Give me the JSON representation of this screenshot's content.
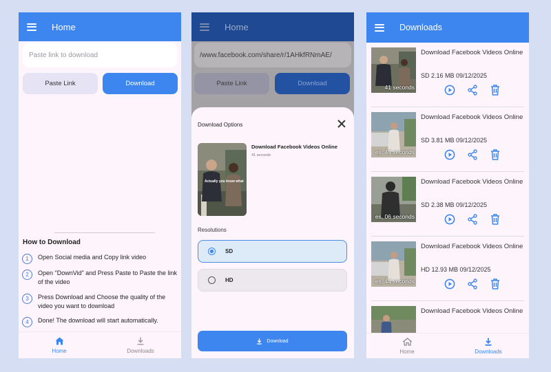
{
  "colors": {
    "accent": "#3d86f0",
    "background": "#d6def3",
    "phone_bg": "#fdf5fb"
  },
  "home": {
    "title": "Home",
    "input_placeholder": "Paste link to download",
    "paste_label": "Paste Link",
    "download_label": "Download",
    "howto_title": "How to Download",
    "steps": [
      {
        "num": "1",
        "text": "Open Social media and Copy link video"
      },
      {
        "num": "2",
        "text": "Open \"DownVid\" and Press Paste to Paste the link of the video"
      },
      {
        "num": "3",
        "text": "Press Download and Choose the quality of the video you want to download"
      },
      {
        "num": "4",
        "text": "Done! The download will start automatically."
      }
    ],
    "nav": {
      "home": "Home",
      "downloads": "Downloads"
    }
  },
  "options": {
    "title": "Home",
    "url_value": "/www.facebook.com/share/r/1AHkfRNmAE/",
    "paste_label": "Paste Link",
    "download_label": "Download",
    "sheet_title": "Download Options",
    "video_title": "Download Facebook Videos Online",
    "video_duration": "41 seconds",
    "thumb_caption": "Actually you know what",
    "resolutions_label": "Resolutions",
    "res_sd": "SD",
    "res_hd": "HD",
    "selected": "SD",
    "download_button": "Download"
  },
  "downloads": {
    "title": "Downloads",
    "items": [
      {
        "title": "Download Facebook Videos Online",
        "meta": "SD 2.16 MB 09/12/2025",
        "duration": "41 seconds"
      },
      {
        "title": "Download Facebook Videos Online",
        "meta": "SD 3.81 MB 09/12/2025",
        "duration": "es, 44 seconds"
      },
      {
        "title": "Download Facebook Videos Online",
        "meta": "SD 2.38 MB 09/12/2025",
        "duration": "es, 06 seconds"
      },
      {
        "title": "Download Facebook Videos Online",
        "meta": "HD 12.93 MB 09/12/2025",
        "duration": "es, 44 seconds"
      },
      {
        "title": "Download Facebook Videos Online",
        "meta": "",
        "duration": ""
      }
    ],
    "nav": {
      "home": "Home",
      "downloads": "Downloads"
    }
  }
}
